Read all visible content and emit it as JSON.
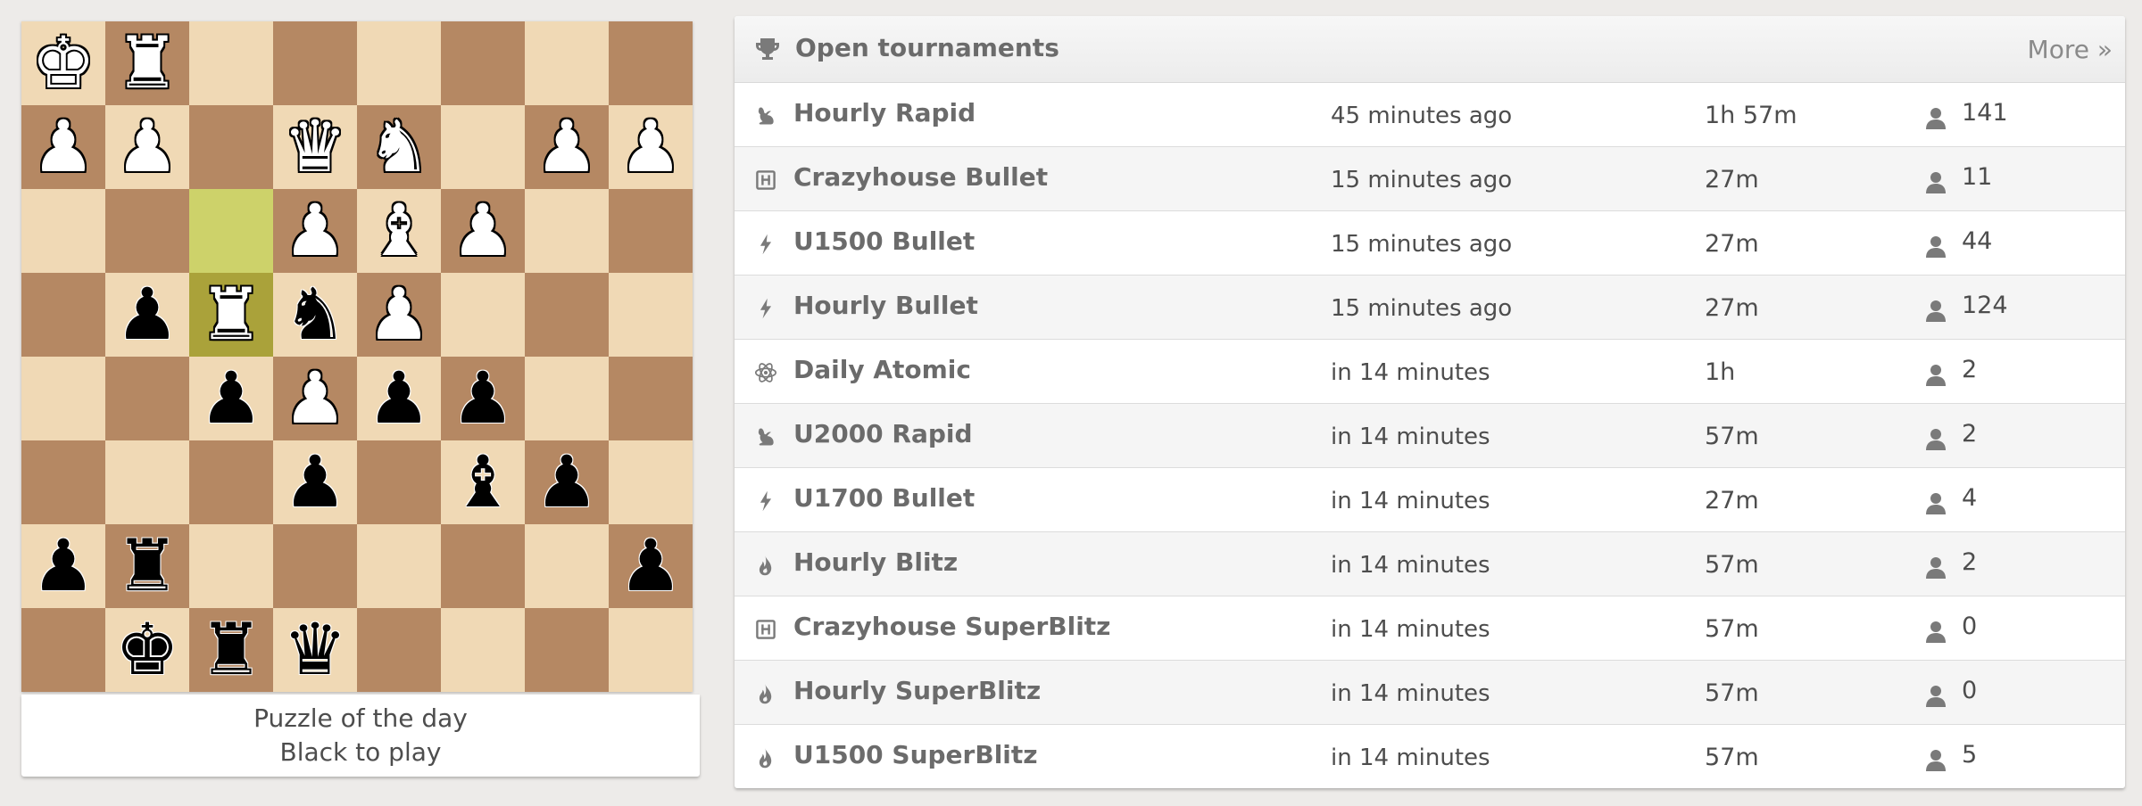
{
  "puzzle": {
    "caption_line1": "Puzzle of the day",
    "caption_line2": "Black to play",
    "colors": {
      "light": "#f0d9b5",
      "dark": "#b58863",
      "highlight_light": "#cdd26a",
      "highlight_dark": "#aaa23a"
    },
    "highlights": [
      "c6",
      "c5"
    ],
    "board": [
      [
        "wK",
        "wR",
        "",
        "",
        "",
        "",
        "",
        ""
      ],
      [
        "wP",
        "wP",
        "",
        "wQ",
        "wN",
        "",
        "wP",
        "wP"
      ],
      [
        "",
        "",
        "",
        "wP",
        "wB",
        "wP",
        "",
        ""
      ],
      [
        "",
        "bP",
        "wR",
        "bN",
        "wP",
        "",
        "",
        ""
      ],
      [
        "",
        "",
        "bP",
        "wP",
        "bP",
        "bP",
        "",
        ""
      ],
      [
        "",
        "",
        "",
        "bP",
        "",
        "bB",
        "bP",
        ""
      ],
      [
        "bP",
        "bR",
        "",
        "",
        "",
        "",
        "",
        "bP"
      ],
      [
        "",
        "bK",
        "bR",
        "bQ",
        "",
        "",
        "",
        ""
      ]
    ]
  },
  "tournaments": {
    "header": {
      "title": "Open tournaments",
      "more_label": "More »",
      "icon": "trophy-icon"
    },
    "rows": [
      {
        "name": "Hourly Rapid",
        "when": "45 minutes ago",
        "duration": "1h 57m",
        "players": "141",
        "icon": "rabbit-icon"
      },
      {
        "name": "Crazyhouse Bullet",
        "when": "15 minutes ago",
        "duration": "27m",
        "players": "11",
        "icon": "crazyhouse-icon"
      },
      {
        "name": "U1500 Bullet",
        "when": "15 minutes ago",
        "duration": "27m",
        "players": "44",
        "icon": "lightning-icon"
      },
      {
        "name": "Hourly Bullet",
        "when": "15 minutes ago",
        "duration": "27m",
        "players": "124",
        "icon": "lightning-icon"
      },
      {
        "name": "Daily Atomic",
        "when": "in 14 minutes",
        "duration": "1h",
        "players": "2",
        "icon": "atom-icon"
      },
      {
        "name": "U2000 Rapid",
        "when": "in 14 minutes",
        "duration": "57m",
        "players": "2",
        "icon": "rabbit-icon"
      },
      {
        "name": "U1700 Bullet",
        "when": "in 14 minutes",
        "duration": "27m",
        "players": "4",
        "icon": "lightning-icon"
      },
      {
        "name": "Hourly Blitz",
        "when": "in 14 minutes",
        "duration": "57m",
        "players": "2",
        "icon": "fire-icon"
      },
      {
        "name": "Crazyhouse SuperBlitz",
        "when": "in 14 minutes",
        "duration": "57m",
        "players": "0",
        "icon": "crazyhouse-icon"
      },
      {
        "name": "Hourly SuperBlitz",
        "when": "in 14 minutes",
        "duration": "57m",
        "players": "0",
        "icon": "fire-icon"
      },
      {
        "name": "U1500 SuperBlitz",
        "when": "in 14 minutes",
        "duration": "57m",
        "players": "5",
        "icon": "fire-icon"
      }
    ]
  }
}
